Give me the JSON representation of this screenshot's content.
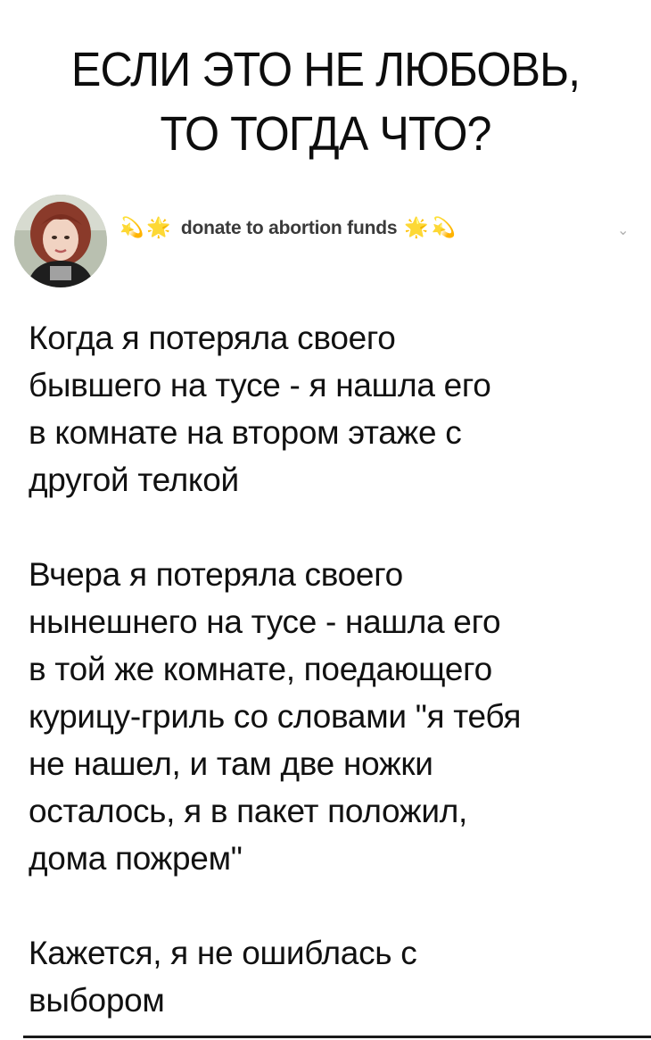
{
  "headline": {
    "line1": "ЕСЛИ ЭТО НЕ ЛЮБОВЬ,",
    "line2": "ТО ТОГДА ЧТО?"
  },
  "post": {
    "username": "donate to abortion funds",
    "emoji_left": [
      "💫",
      "🌟"
    ],
    "emoji_right": [
      "🌟",
      "💫"
    ],
    "paragraphs": [
      {
        "lines": [
          "Когда я потеряла своего",
          "бывшего на тусе - я нашла его",
          "в комнате на втором этаже с",
          "другой телкой"
        ]
      },
      {
        "lines": [
          "Вчера я потеряла своего",
          "нынешнего на тусе - нашла его",
          "в той же комнате, поедающего",
          "курицу-гриль со словами \"я тебя",
          "не нашел, и там две ножки",
          "осталось, я в пакет положил,",
          "дома пожрем\""
        ]
      },
      {
        "lines": [
          "Кажется, я не ошиблась с",
          "выбором"
        ]
      }
    ]
  },
  "icons": {
    "dropdown": "chevron-down-icon",
    "avatar": "user-avatar"
  }
}
